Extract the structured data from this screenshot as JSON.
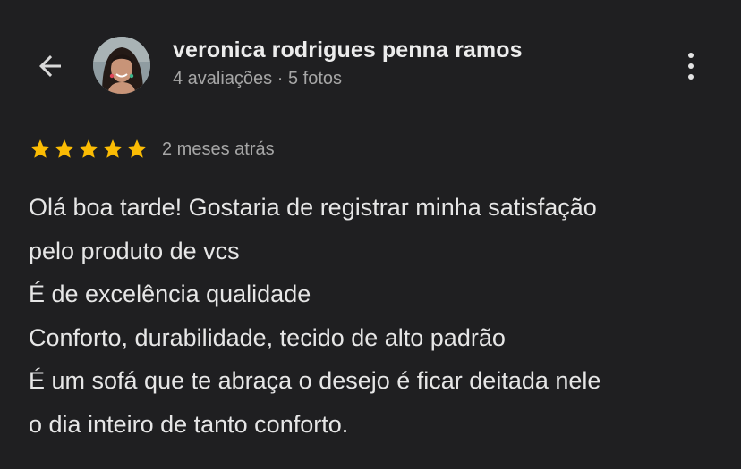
{
  "header": {
    "back_icon": "arrow-back-icon",
    "author_name": "veronica rodrigues penna ramos",
    "author_meta": "4 avaliações · 5 fotos",
    "more_icon": "more-vertical-icon"
  },
  "review": {
    "rating": 5,
    "rating_max": 5,
    "star_color": "#fbbc04",
    "date": "2 meses atrás",
    "lines": [
      "Olá boa tarde! Gostaria de registrar minha satisfação",
      "pelo produto de vcs",
      "É de excelência qualidade",
      "Conforto, durabilidade, tecido de alto padrão",
      "É um sofá que te abraça o desejo é ficar deitada nele",
      "o dia inteiro de tanto conforto."
    ]
  }
}
